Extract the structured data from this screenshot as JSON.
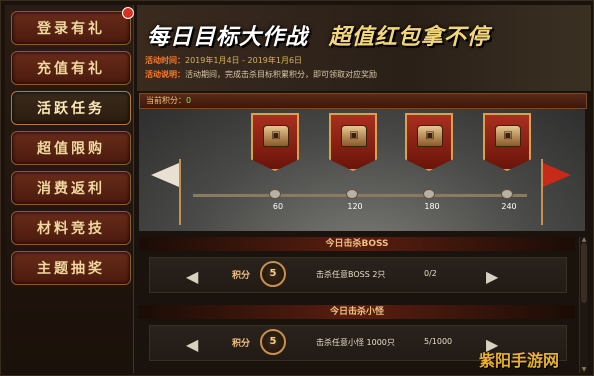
{
  "sidebar": {
    "items": [
      {
        "label": "登录有礼",
        "active": false
      },
      {
        "label": "充值有礼",
        "active": false
      },
      {
        "label": "活跃任务",
        "active": true
      },
      {
        "label": "超值限购",
        "active": false
      },
      {
        "label": "消费返利",
        "active": false
      },
      {
        "label": "材料竞技",
        "active": false
      },
      {
        "label": "主题抽奖",
        "active": false
      }
    ]
  },
  "banner": {
    "title_part1": "每日目标大作战",
    "title_part2": "超值红包拿不停",
    "time_label": "活动时间：",
    "time_value": "2019年1月4日 - 2019年1月6日",
    "desc_label": "活动说明：",
    "desc_value": "活动期间，完成击杀目标积累积分，即可领取对应奖励"
  },
  "score": {
    "label": "当前积分：",
    "value": "0"
  },
  "milestones": [
    "60",
    "120",
    "180",
    "240"
  ],
  "tasks": [
    {
      "title": "今日击杀BOSS",
      "points_label": "积分",
      "points": "5",
      "description": "击杀任意BOSS 2只",
      "progress": "0/2"
    },
    {
      "title": "今日击杀小怪",
      "points_label": "积分",
      "points": "5",
      "description": "击杀任意小怪 1000只",
      "progress": "5/1000"
    }
  ],
  "icons": {
    "chest": "treasure-chest-icon",
    "left_arrow": "left-arrow-icon",
    "right_arrow": "right-arrow-icon",
    "close": "close-icon"
  },
  "watermark": "紫阳手游网",
  "colors": {
    "accent_gold": "#f0c080",
    "score_green": "#7ee060",
    "label_orange": "#ff7a2a"
  }
}
